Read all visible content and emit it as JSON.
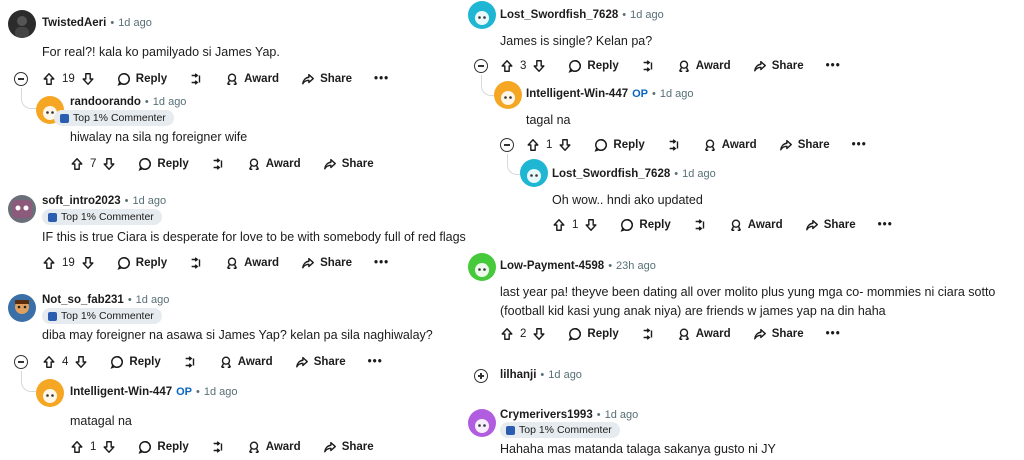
{
  "labels": {
    "reply": "Reply",
    "award": "Award",
    "share": "Share",
    "more": "•••",
    "op": "OP",
    "badge": "Top 1% Commenter",
    "sep": "•"
  },
  "colors": {
    "avatar_dark": "#2b2b2b",
    "avatar_orange": "#f5a623",
    "avatar_teal": "#1fb6d4",
    "avatar_green": "#46c93a",
    "avatar_purple": "#b05de0"
  },
  "left": [
    {
      "user": "TwistedAeri",
      "time": "1d ago",
      "text": "For real?! kala ko pamilyado si James Yap.",
      "votes": "19"
    },
    {
      "user": "randoorando",
      "time": "1d ago",
      "text": "hiwalay na sila ng foreigner wife",
      "votes": "7"
    },
    {
      "user": "soft_intro2023",
      "time": "1d ago",
      "text": "IF this is true Ciara is desperate for love to be with somebody full of red flags",
      "votes": "19"
    },
    {
      "user": "Not_so_fab231",
      "time": "1d ago",
      "text": "diba may foreigner na asawa si James Yap? kelan pa sila naghiwalay?",
      "votes": "4"
    },
    {
      "user": "Intelligent-Win-447",
      "time": "1d ago",
      "text": "matagal na",
      "votes": "1"
    }
  ],
  "right": [
    {
      "user": "Lost_Swordfish_7628",
      "time": "1d ago",
      "text": "James is single? Kelan pa?",
      "votes": "3"
    },
    {
      "user": "Intelligent-Win-447",
      "time": "1d ago",
      "text": "tagal na",
      "votes": "1"
    },
    {
      "user": "Lost_Swordfish_7628",
      "time": "1d ago",
      "text": "Oh wow.. hndi ako updated",
      "votes": "1"
    },
    {
      "user": "Low-Payment-4598",
      "time": "23h ago",
      "text": "last year pa! theyve been dating all over molito plus yung mga co- mommies ni ciara sotto (football kid kasi yung anak niya) are friends w james yap na din haha",
      "votes": "2"
    },
    {
      "user": "lilhanji",
      "time": "1d ago"
    },
    {
      "user": "Crymerivers1993",
      "time": "1d ago",
      "text": "Hahaha mas matanda talaga sakanya gusto ni JY"
    }
  ]
}
